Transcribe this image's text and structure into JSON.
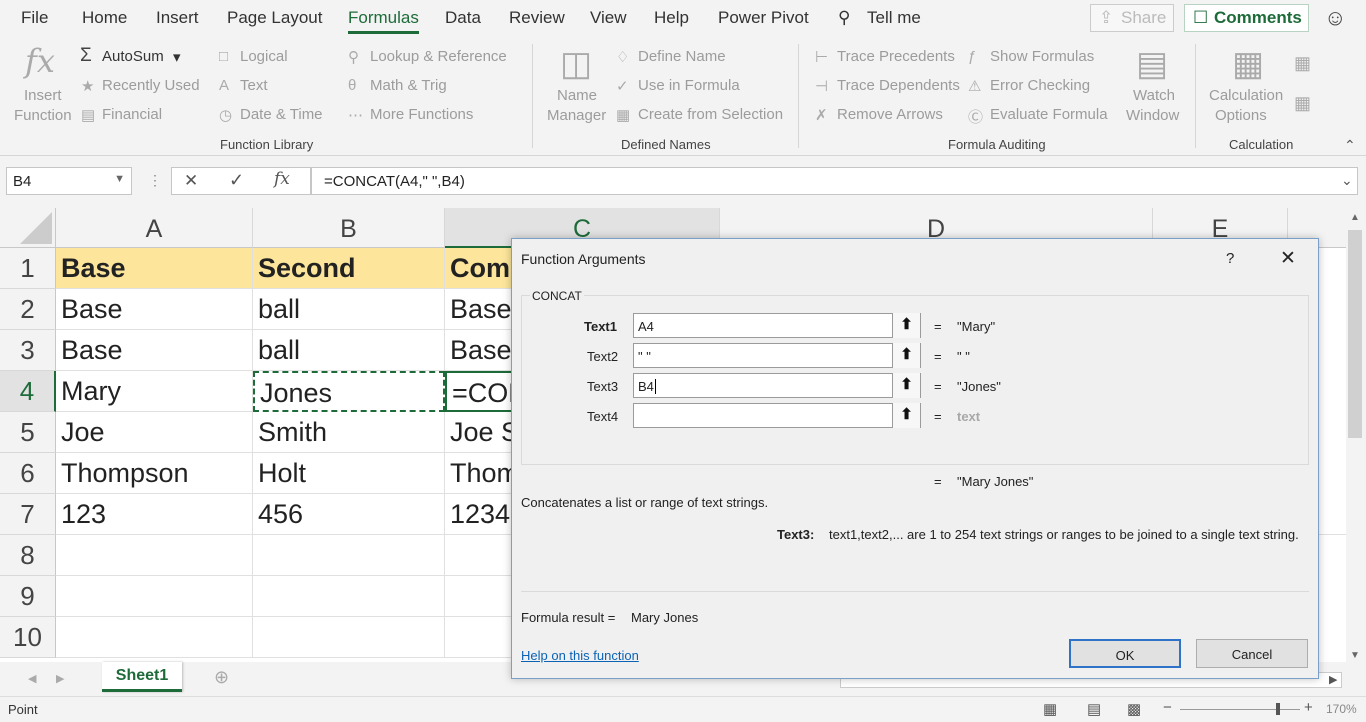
{
  "menubar": {
    "items": [
      "File",
      "Home",
      "Insert",
      "Page Layout",
      "Formulas",
      "Data",
      "Review",
      "View",
      "Help",
      "Power Pivot"
    ],
    "active": "Formulas",
    "tell_me": "Tell me",
    "share": "Share",
    "comments": "Comments"
  },
  "ribbon": {
    "insert_function": [
      "Insert",
      "Function"
    ],
    "function_library": {
      "autosum": "AutoSum",
      "recently_used": "Recently Used",
      "financial": "Financial",
      "logical": "Logical",
      "text": "Text",
      "date_time": "Date & Time",
      "lookup_reference": "Lookup & Reference",
      "math_trig": "Math & Trig",
      "more_functions": "More Functions",
      "group_label": "Function Library"
    },
    "defined_names": {
      "name_manager": [
        "Name",
        "Manager"
      ],
      "define_name": "Define Name",
      "use_in_formula": "Use in Formula",
      "create_from_selection": "Create from Selection",
      "group_label": "Defined Names"
    },
    "formula_auditing": {
      "trace_precedents": "Trace Precedents",
      "trace_dependents": "Trace Dependents",
      "remove_arrows": "Remove Arrows",
      "show_formulas": "Show Formulas",
      "error_checking": "Error Checking",
      "evaluate_formula": "Evaluate Formula",
      "watch_window": [
        "Watch",
        "Window"
      ],
      "group_label": "Formula Auditing"
    },
    "calculation": {
      "calculation_options": [
        "Calculation",
        "Options"
      ],
      "group_label": "Calculation"
    }
  },
  "formula_bar": {
    "name_box": "B4",
    "formula": "=CONCAT(A4,\" \",B4)"
  },
  "sheet": {
    "columns": [
      "A",
      "B",
      "C",
      "D",
      "E"
    ],
    "selected_column": "C",
    "rows": [
      "1",
      "2",
      "3",
      "4",
      "5",
      "6",
      "7",
      "8",
      "9",
      "10"
    ],
    "selected_row": "4",
    "cells": [
      [
        "Base",
        "Second",
        "Com"
      ],
      [
        "Base",
        "ball",
        "Base"
      ],
      [
        "Base",
        "ball",
        "Base"
      ],
      [
        "Mary",
        "Jones",
        "=CON"
      ],
      [
        "Joe",
        "Smith",
        "Joe S"
      ],
      [
        "Thompson",
        "Holt",
        "Thom"
      ],
      [
        "123",
        "456",
        "1234"
      ]
    ],
    "tab": "Sheet1"
  },
  "status": {
    "mode": "Point",
    "zoom": "170%"
  },
  "dialog": {
    "title": "Function Arguments",
    "help_glyph": "?",
    "function_name": "CONCAT",
    "args": [
      {
        "label": "Text1",
        "value": "A4",
        "result": "\"Mary\""
      },
      {
        "label": "Text2",
        "value": "\" \"",
        "result": "\" \""
      },
      {
        "label": "Text3",
        "value": "B4",
        "result": "\"Jones\""
      },
      {
        "label": "Text4",
        "value": "",
        "result": "text"
      }
    ],
    "overall_result": "\"Mary Jones\"",
    "description": "Concatenates a list or range of text strings.",
    "arg_help_label": "Text3:",
    "arg_help_text": "text1,text2,... are 1 to 254 text strings or ranges to be joined to a single text string.",
    "formula_result_label": "Formula result =",
    "formula_result_value": "Mary Jones",
    "help_link": "Help on this function",
    "ok": "OK",
    "cancel": "Cancel"
  }
}
